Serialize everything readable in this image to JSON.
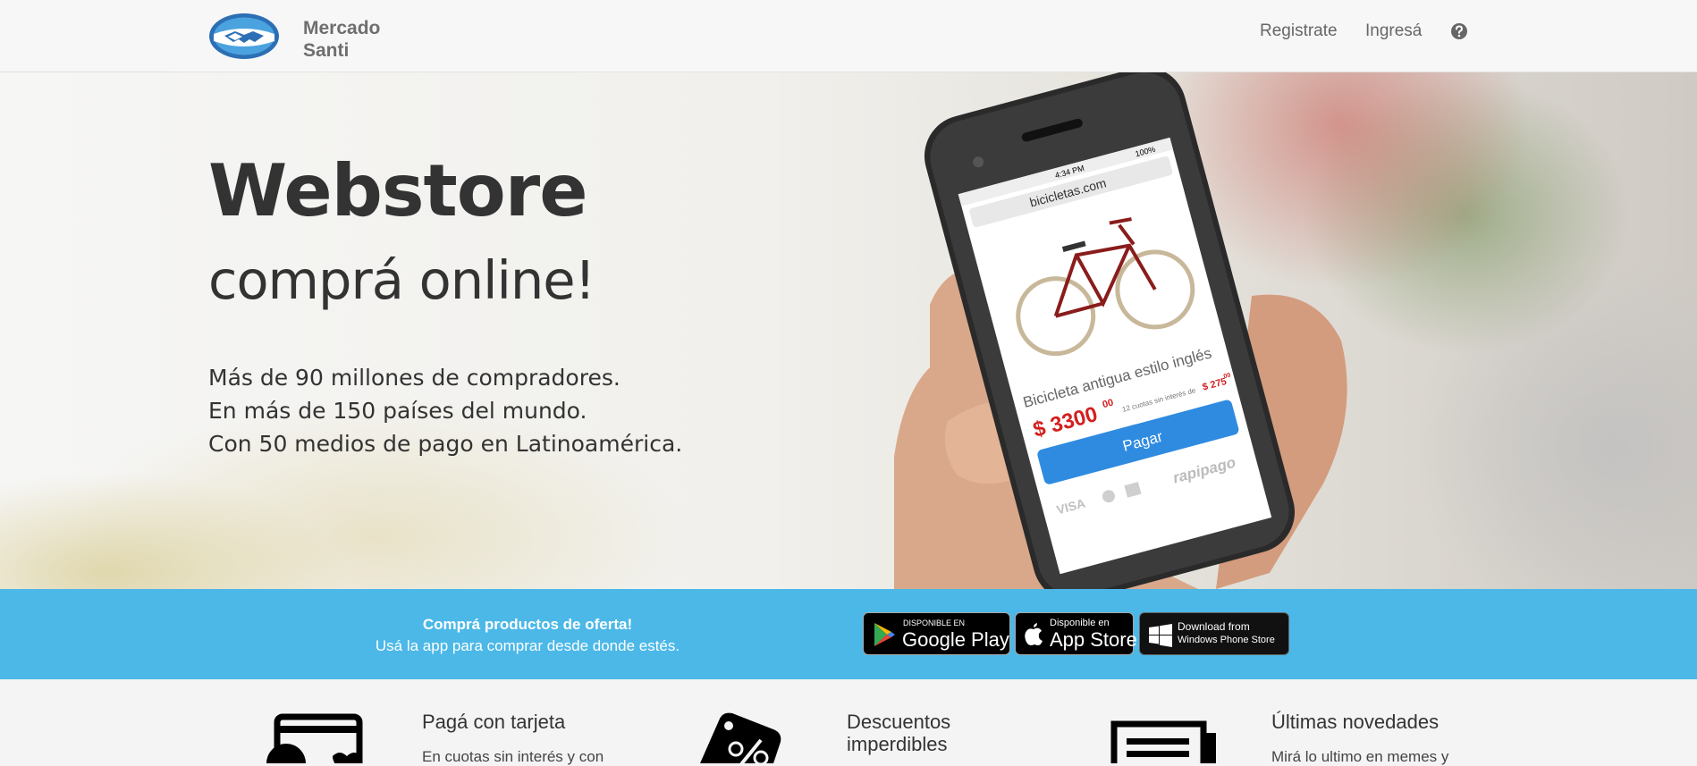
{
  "header": {
    "logo_line1": "Mercado",
    "logo_line2": "Santi",
    "nav": {
      "register": "Registrate",
      "login": "Ingresá"
    }
  },
  "hero": {
    "title": "Webstore",
    "subtitle": "comprá online!",
    "lines": [
      "Más de 90 millones de compradores.",
      "En más de 150 países del mundo.",
      "Con 50 medios de pago en Latinoamérica."
    ],
    "phone": {
      "time": "4:34 PM",
      "battery": "100%",
      "url": "bicicletas.com",
      "product": "Bicicleta antigua estilo inglés",
      "price": "$ 3300",
      "price_cents": "00",
      "installments": "12 cuotas sin interés de",
      "installment_price": "$ 275",
      "installment_cents": "00",
      "pay_button": "Pagar",
      "payment_brand": "rapipago",
      "visa": "VISA"
    }
  },
  "band": {
    "headline": "Comprá productos de oferta!",
    "subline": "Usá la app para comprar desde donde estés.",
    "google_small": "DISPONIBLE EN",
    "google_big": "Google Play",
    "apple_small": "Disponible en",
    "apple_big": "App Store",
    "windows_line1": "Download from",
    "windows_line2": "Windows Phone Store"
  },
  "features": [
    {
      "title": "Pagá con tarjeta",
      "desc": "En cuotas sin interés y con"
    },
    {
      "title_line1": "Descuentos",
      "title_line2": "imperdibles",
      "desc": ""
    },
    {
      "title": "Últimas novedades",
      "desc": "Mirá lo ultimo en memes y"
    }
  ],
  "colors": {
    "band_blue": "#4bb8e8",
    "logo_blue": "#2d6fb5",
    "pay_blue": "#2e8be0",
    "price_red": "#d32020"
  }
}
